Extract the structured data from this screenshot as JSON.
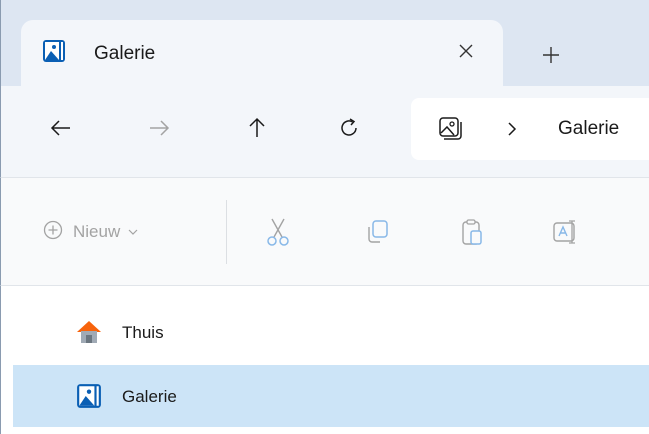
{
  "tab": {
    "title": "Galerie",
    "icon": "gallery-icon",
    "close_icon": "close-icon",
    "new_tab_icon": "plus-icon"
  },
  "nav": {
    "back_icon": "arrow-left-icon",
    "forward_icon": "arrow-right-icon",
    "up_icon": "arrow-up-icon",
    "refresh_icon": "refresh-icon"
  },
  "address": {
    "location_icon": "gallery-outline-icon",
    "separator_icon": "chevron-right-icon",
    "crumb": "Galerie"
  },
  "command_bar": {
    "new_label": "Nieuw",
    "new_icon": "plus-circle-icon",
    "cut_icon": "scissors-icon",
    "copy_icon": "copy-icon",
    "paste_icon": "clipboard-icon",
    "rename_icon": "rename-icon"
  },
  "sidebar": {
    "items": [
      {
        "label": "Thuis",
        "icon": "home-icon",
        "selected": false
      },
      {
        "label": "Galerie",
        "icon": "gallery-icon",
        "selected": true
      }
    ]
  },
  "colors": {
    "accent": "#0067c0",
    "selection": "#cce4f7",
    "tabbar": "#dde6f2",
    "disabled": "#a3a3a3"
  }
}
